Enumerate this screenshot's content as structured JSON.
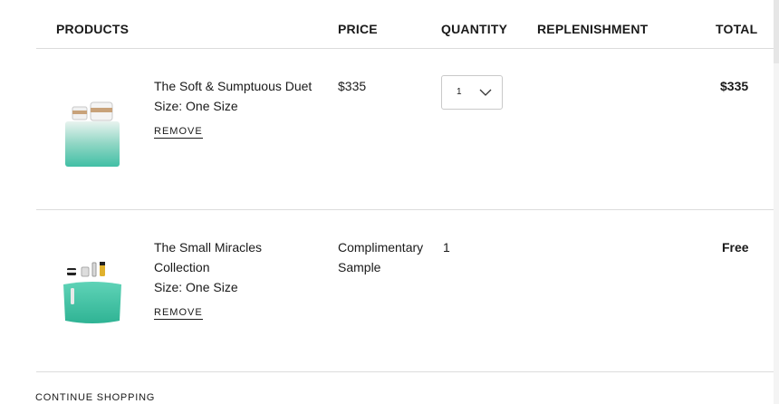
{
  "columns": {
    "products": "PRODUCTS",
    "price": "PRICE",
    "quantity": "QUANTITY",
    "replenishment": "REPLENISHMENT",
    "total": "TOTAL"
  },
  "items": [
    {
      "name": "The Soft & Sumptuous Duet",
      "size": "Size: One Size",
      "remove": "REMOVE",
      "price": "$335",
      "quantity": "1",
      "total": "$335"
    },
    {
      "name_line1": "The Small Miracles",
      "name_line2": "Collection",
      "size": "Size: One Size",
      "remove": "REMOVE",
      "price_line1": "Complimentary",
      "price_line2": "Sample",
      "quantity": "1",
      "total": "Free"
    }
  ],
  "footer": {
    "continue_shopping": "CONTINUE SHOPPING"
  },
  "icons": {
    "qty_dropdown": "chevron-down-icon"
  }
}
